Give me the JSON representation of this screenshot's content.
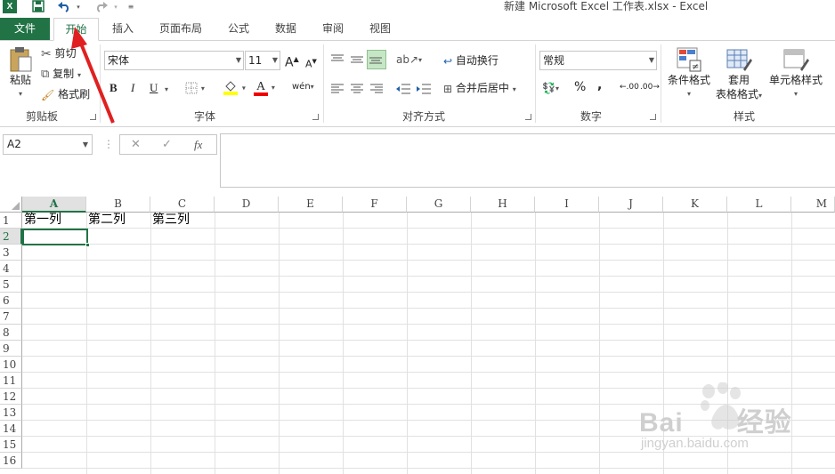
{
  "window": {
    "title": "新建 Microsoft Excel 工作表.xlsx - Excel",
    "logo_text": "X",
    "undo_icon": "undo-icon",
    "redo_icon": "redo-icon"
  },
  "tabs": {
    "file": "文件",
    "items": [
      "开始",
      "插入",
      "页面布局",
      "公式",
      "数据",
      "审阅",
      "视图"
    ],
    "active": "开始"
  },
  "ribbon": {
    "clipboard": {
      "paste": "粘贴",
      "cut": "剪切",
      "copy": "复制",
      "format_painter": "格式刷",
      "label": "剪贴板"
    },
    "font": {
      "font_name": "宋体",
      "font_size": "11",
      "bold": "B",
      "italic": "I",
      "underline": "U",
      "grow": "A",
      "shrink": "A",
      "font_color_letter": "A",
      "wen_label": "wén",
      "label": "字体"
    },
    "alignment": {
      "wrap_text": "自动换行",
      "merge_center": "合并后居中",
      "label": "对齐方式"
    },
    "number": {
      "format": "常规",
      "percent": "%",
      "comma": ",",
      "increase_decimal": ".00",
      "decrease_decimal": ".00",
      "label": "数字"
    },
    "styles": {
      "conditional_format": "条件格式",
      "table_format_line1": "套用",
      "table_format_line2": "表格格式",
      "cell_styles": "单元格样式",
      "label": "样式"
    }
  },
  "formula_bar": {
    "name_box": "A2",
    "cancel": "✕",
    "enter": "✓",
    "fx": "fx",
    "formula": ""
  },
  "sheet": {
    "columns": [
      "A",
      "B",
      "C",
      "D",
      "E",
      "F",
      "G",
      "H",
      "I",
      "J",
      "K",
      "L",
      "M"
    ],
    "rows": [
      "1",
      "2",
      "3",
      "4",
      "5",
      "6",
      "7",
      "8",
      "9",
      "10",
      "11",
      "12",
      "13",
      "14",
      "15",
      "16"
    ],
    "selected_column": "A",
    "selected_row": "2",
    "cells": {
      "A1": "第一列",
      "B1": "第二列",
      "C1": "第三列"
    }
  },
  "watermark": {
    "brand": "Bai",
    "brand_suffix": "经验",
    "url": "jingyan.baidu.com"
  },
  "colors": {
    "accent": "#217346",
    "arrow": "#e02020"
  }
}
